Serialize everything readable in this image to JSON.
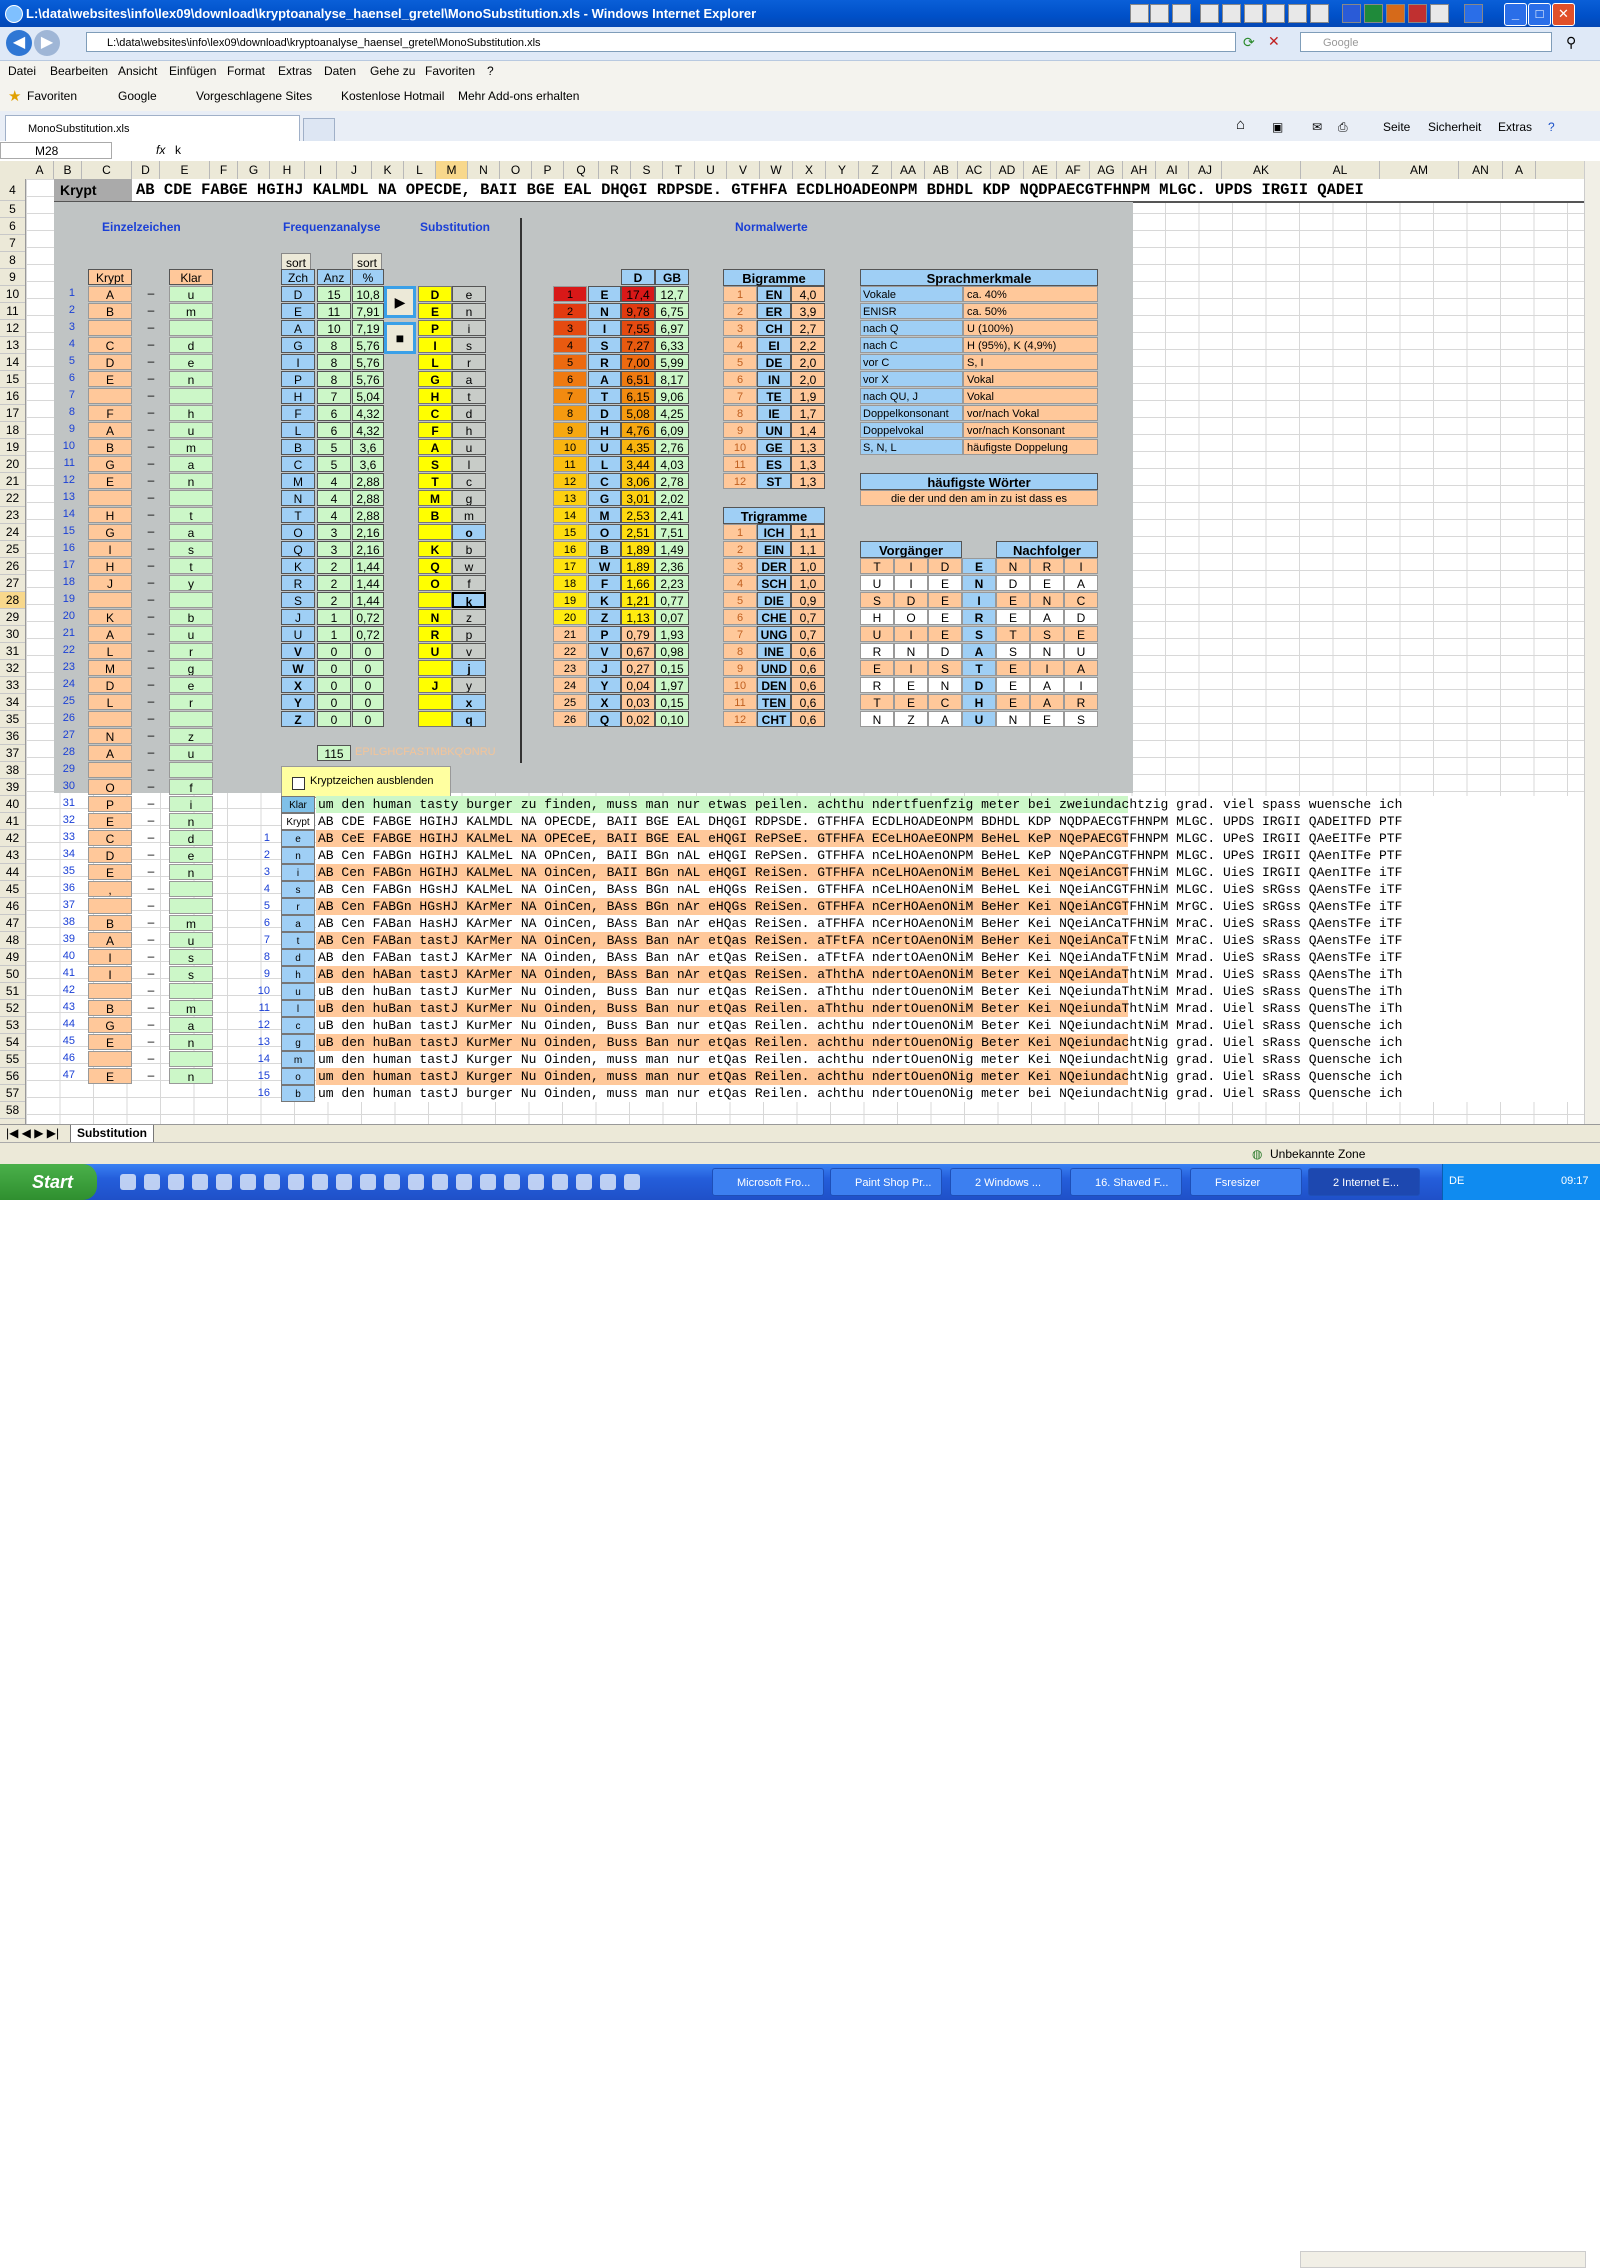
{
  "window": {
    "title": "L:\\data\\websites\\info\\lex09\\download\\kryptoanalyse_haensel_gretel\\MonoSubstitution.xls - Windows Internet Explorer",
    "address": "L:\\data\\websites\\info\\lex09\\download\\kryptoanalyse_haensel_gretel\\MonoSubstitution.xls",
    "search_placeholder": "Google"
  },
  "menu": [
    "Datei",
    "Bearbeiten",
    "Ansicht",
    "Einfügen",
    "Format",
    "Extras",
    "Daten",
    "Gehe zu",
    "Favoriten",
    "?"
  ],
  "favorites": {
    "label": "Favoriten",
    "links": [
      "Google",
      "Vorgeschlagene Sites",
      "Kostenlose Hotmail",
      "Mehr Add-ons erhalten"
    ]
  },
  "tab": {
    "label": "MonoSubstitution.xls"
  },
  "commands": [
    "Seite",
    "Sicherheit",
    "Extras"
  ],
  "formula": {
    "cell": "M28",
    "fx": "fx",
    "value": "k"
  },
  "columns": [
    "A",
    "B",
    "C",
    "D",
    "E",
    "F",
    "G",
    "H",
    "I",
    "J",
    "K",
    "L",
    "M",
    "N",
    "O",
    "P",
    "Q",
    "R",
    "S",
    "T",
    "U",
    "V",
    "W",
    "X",
    "Y",
    "Z",
    "AA",
    "AB",
    "AC",
    "AD",
    "AE",
    "AF",
    "AG",
    "AH",
    "AI",
    "AJ",
    "AK",
    "AL",
    "AM",
    "AN",
    "A"
  ],
  "rows": [
    4,
    5,
    6,
    7,
    8,
    9,
    10,
    11,
    12,
    13,
    14,
    15,
    16,
    17,
    18,
    19,
    20,
    21,
    22,
    23,
    24,
    25,
    26,
    27,
    28,
    29,
    30,
    31,
    32,
    33,
    34,
    35,
    36,
    37,
    38,
    39,
    40,
    41,
    42,
    43,
    44,
    45,
    46,
    47,
    48,
    49,
    50,
    51,
    52,
    53,
    54,
    55,
    56,
    57,
    58
  ],
  "krypt_label": "Krypt",
  "krypt_line": "AB CDE FABGE HGIHJ KALMDL NA OPECDE, BAII BGE EAL DHQGI RDPSDE. GTFHFA ECDLHOADEONPM BDHDL KDP NQDPAECGTFHNPM MLGC. UPDS IRGII QADEI",
  "sections": {
    "einzel": "Einzelzeichen",
    "freq": "Frequenzanalyse",
    "subst": "Substitution",
    "normal": "Normalwerte"
  },
  "einzel": {
    "header_krypt": "Krypt",
    "header_klar": "Klar",
    "dash": "–",
    "rows": [
      [
        "1",
        "A",
        "u"
      ],
      [
        "2",
        "B",
        "m"
      ],
      [
        "3",
        "",
        ""
      ],
      [
        "4",
        "C",
        "d"
      ],
      [
        "5",
        "D",
        "e"
      ],
      [
        "6",
        "E",
        "n"
      ],
      [
        "7",
        "",
        ""
      ],
      [
        "8",
        "F",
        "h"
      ],
      [
        "9",
        "A",
        "u"
      ],
      [
        "10",
        "B",
        "m"
      ],
      [
        "11",
        "G",
        "a"
      ],
      [
        "12",
        "E",
        "n"
      ],
      [
        "13",
        "",
        ""
      ],
      [
        "14",
        "H",
        "t"
      ],
      [
        "15",
        "G",
        "a"
      ],
      [
        "16",
        "I",
        "s"
      ],
      [
        "17",
        "H",
        "t"
      ],
      [
        "18",
        "J",
        "y"
      ],
      [
        "19",
        "",
        ""
      ],
      [
        "20",
        "K",
        "b"
      ],
      [
        "21",
        "A",
        "u"
      ],
      [
        "22",
        "L",
        "r"
      ],
      [
        "23",
        "M",
        "g"
      ],
      [
        "24",
        "D",
        "e"
      ],
      [
        "25",
        "L",
        "r"
      ],
      [
        "26",
        "",
        ""
      ],
      [
        "27",
        "N",
        "z"
      ],
      [
        "28",
        "A",
        "u"
      ],
      [
        "29",
        "",
        ""
      ],
      [
        "30",
        "O",
        "f"
      ],
      [
        "31",
        "P",
        "i"
      ],
      [
        "32",
        "E",
        "n"
      ],
      [
        "33",
        "C",
        "d"
      ],
      [
        "34",
        "D",
        "e"
      ],
      [
        "35",
        "E",
        "n"
      ],
      [
        "36",
        ",",
        ""
      ],
      [
        "37",
        "",
        ""
      ],
      [
        "38",
        "B",
        "m"
      ],
      [
        "39",
        "A",
        "u"
      ],
      [
        "40",
        "I",
        "s"
      ],
      [
        "41",
        "I",
        "s"
      ],
      [
        "42",
        "",
        ""
      ],
      [
        "43",
        "B",
        "m"
      ],
      [
        "44",
        "G",
        "a"
      ],
      [
        "45",
        "E",
        "n"
      ],
      [
        "46",
        "",
        ""
      ],
      [
        "47",
        "E",
        "n"
      ]
    ]
  },
  "freq": {
    "sort_label": "sort",
    "headers": [
      "Zch",
      "Anz",
      "%"
    ],
    "rows": [
      [
        "D",
        "15",
        "10,8"
      ],
      [
        "E",
        "11",
        "7,91"
      ],
      [
        "A",
        "10",
        "7,19"
      ],
      [
        "G",
        "8",
        "5,76"
      ],
      [
        "I",
        "8",
        "5,76"
      ],
      [
        "P",
        "8",
        "5,76"
      ],
      [
        "H",
        "7",
        "5,04"
      ],
      [
        "F",
        "6",
        "4,32"
      ],
      [
        "L",
        "6",
        "4,32"
      ],
      [
        "B",
        "5",
        "3,6"
      ],
      [
        "C",
        "5",
        "3,6"
      ],
      [
        "M",
        "4",
        "2,88"
      ],
      [
        "N",
        "4",
        "2,88"
      ],
      [
        "T",
        "4",
        "2,88"
      ],
      [
        "O",
        "3",
        "2,16"
      ],
      [
        "Q",
        "3",
        "2,16"
      ],
      [
        "K",
        "2",
        "1,44"
      ],
      [
        "R",
        "2",
        "1,44"
      ],
      [
        "S",
        "2",
        "1,44"
      ],
      [
        "J",
        "1",
        "0,72"
      ],
      [
        "U",
        "1",
        "0,72"
      ],
      [
        "V",
        "0",
        "0"
      ],
      [
        "W",
        "0",
        "0"
      ],
      [
        "X",
        "0",
        "0"
      ],
      [
        "Y",
        "0",
        "0"
      ],
      [
        "Z",
        "0",
        "0"
      ]
    ],
    "total": "115",
    "order_string": "EPILGHCFASTMBKQONRU"
  },
  "subst": {
    "play_icon": "▶",
    "stop_icon": "■",
    "rows": [
      [
        "D",
        "e"
      ],
      [
        "E",
        "n"
      ],
      [
        "P",
        "i"
      ],
      [
        "I",
        "s"
      ],
      [
        "L",
        "r"
      ],
      [
        "G",
        "a"
      ],
      [
        "H",
        "t"
      ],
      [
        "C",
        "d"
      ],
      [
        "F",
        "h"
      ],
      [
        "A",
        "u"
      ],
      [
        "S",
        "l"
      ],
      [
        "T",
        "c"
      ],
      [
        "M",
        "g"
      ],
      [
        "B",
        "m"
      ],
      [
        "",
        "o"
      ],
      [
        "K",
        "b"
      ],
      [
        "Q",
        "w"
      ],
      [
        "O",
        "f"
      ],
      [
        "",
        "k"
      ],
      [
        "N",
        "z"
      ],
      [
        "R",
        "p"
      ],
      [
        "U",
        "v"
      ],
      [
        "",
        "j"
      ],
      [
        "J",
        "y"
      ],
      [
        "",
        "x"
      ],
      [
        "",
        "q"
      ]
    ]
  },
  "normal": {
    "headers": [
      "D",
      "GB"
    ],
    "rows": [
      [
        "1",
        "E",
        "17,4",
        "12,7"
      ],
      [
        "2",
        "N",
        "9,78",
        "6,75"
      ],
      [
        "3",
        "I",
        "7,55",
        "6,97"
      ],
      [
        "4",
        "S",
        "7,27",
        "6,33"
      ],
      [
        "5",
        "R",
        "7,00",
        "5,99"
      ],
      [
        "6",
        "A",
        "6,51",
        "8,17"
      ],
      [
        "7",
        "T",
        "6,15",
        "9,06"
      ],
      [
        "8",
        "D",
        "5,08",
        "4,25"
      ],
      [
        "9",
        "H",
        "4,76",
        "6,09"
      ],
      [
        "10",
        "U",
        "4,35",
        "2,76"
      ],
      [
        "11",
        "L",
        "3,44",
        "4,03"
      ],
      [
        "12",
        "C",
        "3,06",
        "2,78"
      ],
      [
        "13",
        "G",
        "3,01",
        "2,02"
      ],
      [
        "14",
        "M",
        "2,53",
        "2,41"
      ],
      [
        "15",
        "O",
        "2,51",
        "7,51"
      ],
      [
        "16",
        "B",
        "1,89",
        "1,49"
      ],
      [
        "17",
        "W",
        "1,89",
        "2,36"
      ],
      [
        "18",
        "F",
        "1,66",
        "2,23"
      ],
      [
        "19",
        "K",
        "1,21",
        "0,77"
      ],
      [
        "20",
        "Z",
        "1,13",
        "0,07"
      ],
      [
        "21",
        "P",
        "0,79",
        "1,93"
      ],
      [
        "22",
        "V",
        "0,67",
        "0,98"
      ],
      [
        "23",
        "J",
        "0,27",
        "0,15"
      ],
      [
        "24",
        "Y",
        "0,04",
        "1,97"
      ],
      [
        "25",
        "X",
        "0,03",
        "0,15"
      ],
      [
        "26",
        "Q",
        "0,02",
        "0,10"
      ]
    ],
    "colors": [
      "#d81818",
      "#e23a10",
      "#e54a10",
      "#e85a10",
      "#ec6a10",
      "#ef7a10",
      "#f28a10",
      "#f59a10",
      "#f7a810",
      "#f9b410",
      "#fbbe10",
      "#fcc810",
      "#fdd010",
      "#fed810",
      "#fedd10",
      "#ffe010",
      "#ffe410",
      "#ffe810",
      "#ffea10",
      "#ffec10"
    ]
  },
  "bigramme": {
    "title": "Bigramme",
    "rows": [
      [
        "1",
        "EN",
        "4,0"
      ],
      [
        "2",
        "ER",
        "3,9"
      ],
      [
        "3",
        "CH",
        "2,7"
      ],
      [
        "4",
        "EI",
        "2,2"
      ],
      [
        "5",
        "DE",
        "2,0"
      ],
      [
        "6",
        "IN",
        "2,0"
      ],
      [
        "7",
        "TE",
        "1,9"
      ],
      [
        "8",
        "IE",
        "1,7"
      ],
      [
        "9",
        "UN",
        "1,4"
      ],
      [
        "10",
        "GE",
        "1,3"
      ],
      [
        "11",
        "ES",
        "1,3"
      ],
      [
        "12",
        "ST",
        "1,3"
      ]
    ]
  },
  "trigramme": {
    "title": "Trigramme",
    "rows": [
      [
        "1",
        "ICH",
        "1,1"
      ],
      [
        "2",
        "EIN",
        "1,1"
      ],
      [
        "3",
        "DER",
        "1,0"
      ],
      [
        "4",
        "SCH",
        "1,0"
      ],
      [
        "5",
        "DIE",
        "0,9"
      ],
      [
        "6",
        "CHE",
        "0,7"
      ],
      [
        "7",
        "UNG",
        "0,7"
      ],
      [
        "8",
        "INE",
        "0,6"
      ],
      [
        "9",
        "UND",
        "0,6"
      ],
      [
        "10",
        "DEN",
        "0,6"
      ],
      [
        "11",
        "TEN",
        "0,6"
      ],
      [
        "12",
        "CHT",
        "0,6"
      ]
    ]
  },
  "sprach": {
    "title": "Sprachmerkmale",
    "rows": [
      [
        "Vokale",
        "ca. 40%"
      ],
      [
        "ENISR",
        "ca. 50%"
      ],
      [
        "nach Q",
        "U (100%)"
      ],
      [
        "nach C",
        "H (95%), K (4,9%)"
      ],
      [
        "vor C",
        "S, I"
      ],
      [
        "vor X",
        "Vokal"
      ],
      [
        "nach QU, J",
        "Vokal"
      ],
      [
        "Doppelkonsonant",
        "vor/nach Vokal"
      ],
      [
        "Doppelvokal",
        "vor/nach Konsonant"
      ],
      [
        "S, N, L",
        "häufigste Doppelung"
      ]
    ]
  },
  "woerter": {
    "title": "häufigste Wörter",
    "text": "die der und den am in zu ist dass es"
  },
  "vorgnach": {
    "title_left": "Vorgänger",
    "title_right": "Nachfolger",
    "rows": [
      [
        "T",
        "I",
        "D",
        "E",
        "N",
        "R",
        "I"
      ],
      [
        "U",
        "I",
        "E",
        "N",
        "D",
        "E",
        "A"
      ],
      [
        "S",
        "D",
        "E",
        "I",
        "E",
        "N",
        "C"
      ],
      [
        "H",
        "O",
        "E",
        "R",
        "E",
        "A",
        "D"
      ],
      [
        "U",
        "I",
        "E",
        "S",
        "T",
        "S",
        "E"
      ],
      [
        "R",
        "N",
        "D",
        "A",
        "S",
        "N",
        "U"
      ],
      [
        "E",
        "I",
        "S",
        "T",
        "E",
        "I",
        "A"
      ],
      [
        "R",
        "E",
        "N",
        "D",
        "E",
        "A",
        "I"
      ],
      [
        "T",
        "E",
        "C",
        "H",
        "E",
        "A",
        "R"
      ],
      [
        "N",
        "Z",
        "A",
        "U",
        "N",
        "E",
        "S"
      ]
    ]
  },
  "checkbox_label": "Kryptzeichen ausblenden",
  "decrypt": {
    "klar_label": "Klar",
    "krypt_label": "Krypt",
    "klar": "um den human tasty burger zu finden, muss man nur etwas peilen. achthu ndertfuenfzig meter bei zweiundachtzig grad. viel spass wuensche ich",
    "krypt": "AB CDE FABGE HGIHJ KALMDL NA OPECDE, BAII BGE EAL DHQGI RDPSDE. GTFHFA ECDLHOADEONPM BDHDL KDP NQDPAECGTFHNPM MLGC. UPDS IRGII QADEITFD PTF",
    "steps": [
      [
        "1",
        "e",
        "AB CeE FABGE HGIHJ KALMeL NA OPECeE, BAII BGE EAL eHQGI RePSeE. GTFHFA ECeLHOAeEONPM BeHeL KeP NQePAECGTFHNPM MLGC. UPeS IRGII QAeEITFe PTF"
      ],
      [
        "2",
        "n",
        "AB Cen FABGn HGIHJ KALMeL NA OPnCen, BAII BGn nAL eHQGI RePSen. GTFHFA nCeLHOAenONPM BeHeL KeP NQePAnCGTFHNPM MLGC. UPeS IRGII QAenITFe PTF"
      ],
      [
        "3",
        "i",
        "AB Cen FABGn HGIHJ KALMeL NA OinCen, BAII BGn nAL eHQGI ReiSen. GTFHFA nCeLHOAenONiM BeHeL Kei NQeiAnCGTFHNiM MLGC. UieS IRGII QAenITFe iTF"
      ],
      [
        "4",
        "s",
        "AB Cen FABGn HGsHJ KALMeL NA OinCen, BAss BGn nAL eHQGs ReiSen. GTFHFA nCeLHOAenONiM BeHeL Kei NQeiAnCGTFHNiM MLGC. UieS sRGss QAensTFe iTF"
      ],
      [
        "5",
        "r",
        "AB Cen FABGn HGsHJ KArMer NA OinCen, BAss BGn nAr eHQGs ReiSen. GTFHFA nCerHOAenONiM BeHer Kei NQeiAnCGTFHNiM MrGC. UieS sRGss QAensTFe iTF"
      ],
      [
        "6",
        "a",
        "AB Cen FABan HasHJ KArMer NA OinCen, BAss Ban nAr eHQas ReiSen. aTFHFA nCerHOAenONiM BeHer Kei NQeiAnCaTFHNiM MraC. UieS sRass QAensTFe iTF"
      ],
      [
        "7",
        "t",
        "AB Cen FABan tastJ KArMer NA OinCen, BAss Ban nAr etQas ReiSen. aTFtFA nCertOAenONiM BeHer Kei NQeiAnCaTFtNiM MraC. UieS sRass QAensTFe iTF"
      ],
      [
        "8",
        "d",
        "AB den FABan tastJ KArMer NA Oinden, BAss Ban nAr etQas ReiSen. aTFtFA ndertOAenONiM BeHer Kei NQeiAndaTFtNiM Mrad. UieS sRass QAensTFe iTF"
      ],
      [
        "9",
        "h",
        "AB den hABan tastJ KArMer NA Oinden, BAss Ban nAr etQas ReiSen. aThthA ndertOAenONiM Beter Kei NQeiAndaThtNiM Mrad. UieS sRass QAensThe iTh"
      ],
      [
        "10",
        "u",
        "uB den huBan tastJ KurMer Nu Oinden, Buss Ban nur etQas ReiSen. aThthu ndertOuenONiM Beter Kei NQeiundaThtNiM Mrad. UieS sRass QuensThe iTh"
      ],
      [
        "11",
        "l",
        "uB den huBan tastJ KurMer Nu Oinden, Buss Ban nur etQas Reilen. aThthu ndertOuenONiM Beter Kei NQeiundaThtNiM Mrad. Uiel sRass QuensThe iTh"
      ],
      [
        "12",
        "c",
        "uB den huBan tastJ KurMer Nu Oinden, Buss Ban nur etQas Reilen. achthu ndertOuenONiM Beter Kei NQeiundachtNiM Mrad. Uiel sRass Quensche ich"
      ],
      [
        "13",
        "g",
        "uB den huBan tastJ KurMer Nu Oinden, Buss Ban nur etQas Reilen. achthu ndertOuenONig Beter Kei NQeiundachtNig grad. Uiel sRass Quensche ich"
      ],
      [
        "14",
        "m",
        "um den human tastJ Kurger Nu Oinden, muss man nur etQas Reilen. achthu ndertOuenONig meter Kei NQeiundachtNig grad. Uiel sRass Quensche ich"
      ],
      [
        "15",
        "o",
        "um den human tastJ Kurger Nu Oinden, muss man nur etQas Reilen. achthu ndertOuenONig meter Kei NQeiundachtNig grad. Uiel sRass Quensche ich"
      ],
      [
        "16",
        "b",
        "um den human tastJ burger Nu Oinden, muss man nur etQas Reilen. achthu ndertOuenONig meter bei NQeiundachtNig grad. Uiel sRass Quensche ich"
      ]
    ]
  },
  "sheet_tab": "Substitution",
  "status": {
    "zone": "Unbekannte Zone"
  },
  "taskbar": {
    "start": "Start",
    "tasks": [
      "Microsoft Fro...",
      "Paint Shop Pr...",
      "2 Windows ...",
      "16. Shaved F...",
      "Fsresizer",
      "2 Internet E..."
    ],
    "lang": "DE",
    "clock": "09:17"
  }
}
